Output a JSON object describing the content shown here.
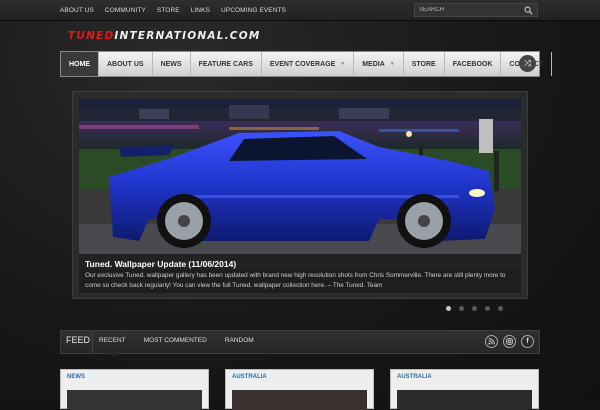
{
  "top_nav": [
    "ABOUT US",
    "COMMUNITY",
    "STORE",
    "LINKS",
    "UPCOMING EVENTS"
  ],
  "search": {
    "placeholder": "SEARCH"
  },
  "logo": {
    "part1": "TUNED",
    "part2": "INTERNATIONAL.COM"
  },
  "main_nav": [
    {
      "label": "HOME",
      "active": true
    },
    {
      "label": "ABOUT US"
    },
    {
      "label": "NEWS"
    },
    {
      "label": "FEATURE CARS"
    },
    {
      "label": "EVENT COVERAGE",
      "dropdown": true
    },
    {
      "label": "MEDIA",
      "dropdown": true
    },
    {
      "label": "STORE"
    },
    {
      "label": "FACEBOOK"
    },
    {
      "label": "CONTACT"
    }
  ],
  "slider": {
    "title": "Tuned. Wallpaper Update (11/06/2014)",
    "text": "Our exclusive Tuned. wallpaper gallery has been updated with brand new high resolution shots from Chris Sommerville. There are still plenty more to come so check back regularly! You can view the full Tuned. wallpaper collection here. – The Tuned. Team",
    "slides": 5,
    "active_slide": 1
  },
  "feed": {
    "label": "FEED",
    "tabs": [
      "RECENT",
      "MOST COMMENTED",
      "RANDOM"
    ],
    "social_icons": [
      "rss-icon",
      "instagram-icon",
      "facebook-icon"
    ]
  },
  "cards": [
    {
      "category": "NEWS"
    },
    {
      "category": "AUSTRALIA"
    },
    {
      "category": "AUSTRALIA"
    }
  ],
  "colors": {
    "logo_red": "#e01919",
    "link_blue": "#2b6ea8",
    "car_blue": "#1f34c8"
  }
}
